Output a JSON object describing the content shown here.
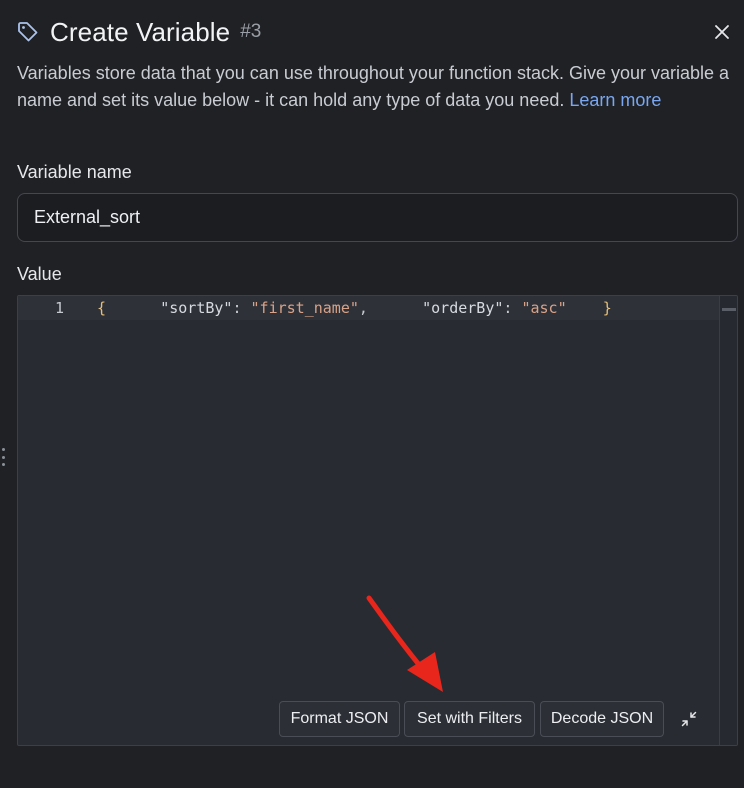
{
  "header": {
    "title": "Create Variable",
    "number": "#3",
    "icon": "tag-icon",
    "close_icon": "close-icon"
  },
  "description": {
    "text": "Variables store data that you can use throughout your function stack. Give your variable a name and set its value below - it can hold any type of data you need. ",
    "link": "Learn more"
  },
  "form": {
    "name_label": "Variable name",
    "name_value": "External_sort",
    "value_label": "Value"
  },
  "editor": {
    "line_number": "1",
    "tokens": {
      "open_brace": "{",
      "key1": "\"sortBy\"",
      "colon1": ": ",
      "val1": "\"first_name\"",
      "comma": ",",
      "key2": "\"orderBy\"",
      "colon2": ": ",
      "val2": "\"asc\"",
      "close_brace": "}"
    }
  },
  "actions": {
    "format_json": "Format JSON",
    "set_with_filters": "Set with Filters",
    "decode_json": "Decode JSON",
    "collapse_icon": "collapse-icon"
  },
  "colors": {
    "background": "#1f2125",
    "editor_bg": "#282b31",
    "link": "#7aa7f0",
    "annotation_arrow": "#e8261c"
  }
}
